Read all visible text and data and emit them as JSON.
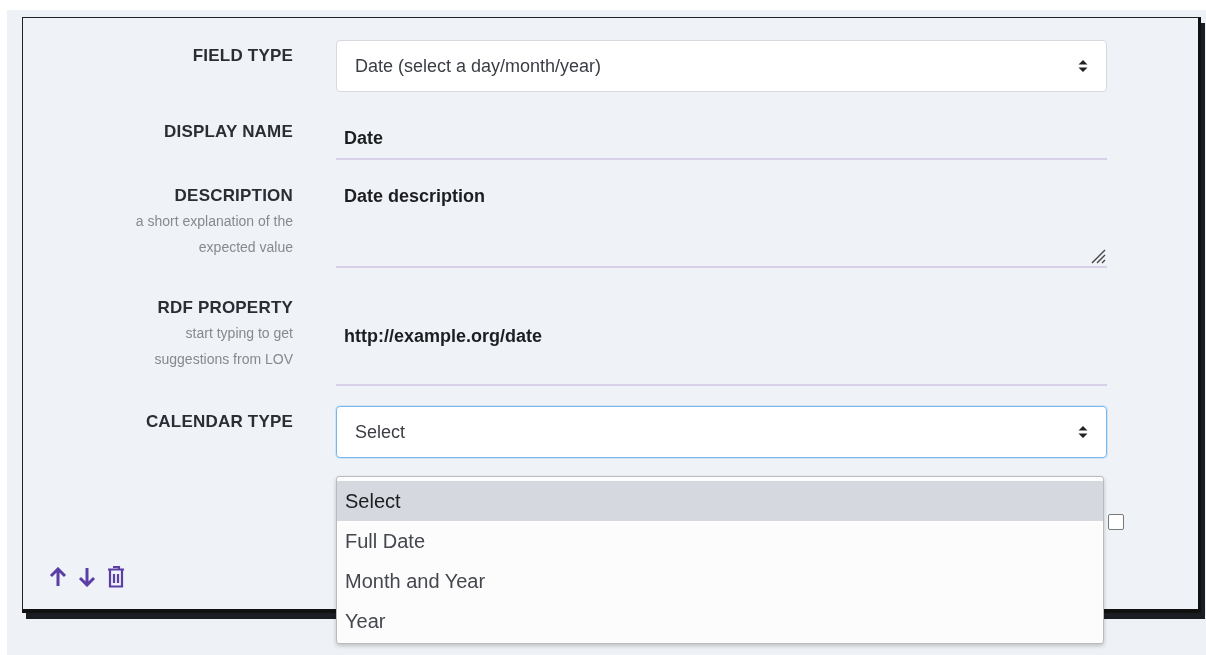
{
  "fields": [
    {
      "kind": "select",
      "label": "FIELD TYPE",
      "value": "Date (select a day/month/year)",
      "focused": false
    },
    {
      "kind": "text",
      "label": "DISPLAY NAME",
      "value": "Date"
    },
    {
      "kind": "textarea",
      "label": "DESCRIPTION",
      "hint": "a short explanation of the expected value",
      "value": "Date description"
    },
    {
      "kind": "text",
      "label": "RDF PROPERTY",
      "hint": "start typing to get suggestions from LOV",
      "value": "http://example.org/date"
    },
    {
      "kind": "select",
      "label": "CALENDAR TYPE",
      "value": "Select",
      "focused": true
    }
  ],
  "dropdown": {
    "options": [
      {
        "label": "Select",
        "selected": true
      },
      {
        "label": "Full Date",
        "selected": false
      },
      {
        "label": "Month and Year",
        "selected": false
      },
      {
        "label": "Year",
        "selected": false
      }
    ]
  },
  "checkbox": {
    "checked": false
  }
}
